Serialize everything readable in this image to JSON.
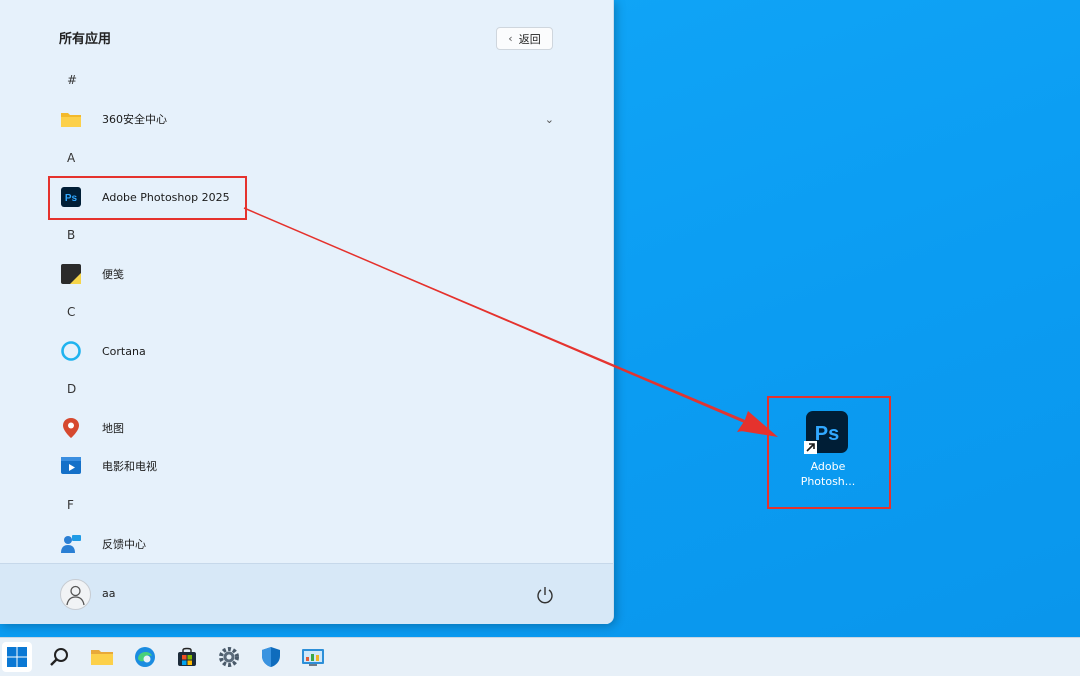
{
  "start_menu": {
    "title": "所有应用",
    "back_label": "返回",
    "sections": [
      {
        "letter": "#"
      },
      {
        "letter": "A"
      },
      {
        "letter": "B"
      },
      {
        "letter": "C"
      },
      {
        "letter": "D"
      },
      {
        "letter": "F"
      }
    ],
    "apps": [
      {
        "label": "360安全中心",
        "icon": "folder-icon"
      },
      {
        "label": "Adobe Photoshop 2025",
        "icon": "photoshop-icon"
      },
      {
        "label": "便笺",
        "icon": "sticky-notes-icon"
      },
      {
        "label": "Cortana",
        "icon": "cortana-icon"
      },
      {
        "label": "地图",
        "icon": "maps-icon"
      },
      {
        "label": "电影和电视",
        "icon": "movies-tv-icon"
      },
      {
        "label": "反馈中心",
        "icon": "feedback-hub-icon"
      }
    ],
    "user": {
      "name": "aa"
    }
  },
  "desktop": {
    "shortcut": {
      "label_line1": "Adobe",
      "label_line2": "Photosh...",
      "icon_text": "Ps"
    }
  },
  "icons": {
    "ps_text": "Ps"
  },
  "taskbar": {
    "items": [
      "start-icon",
      "search-icon",
      "file-explorer-icon",
      "edge-icon",
      "store-icon",
      "settings-icon",
      "security-icon",
      "control-panel-icon"
    ]
  },
  "colors": {
    "desktop": "#0ea2f5",
    "highlight": "#e5322d",
    "photoshop_bg": "#001e36",
    "photoshop_text": "#31a8ff"
  }
}
